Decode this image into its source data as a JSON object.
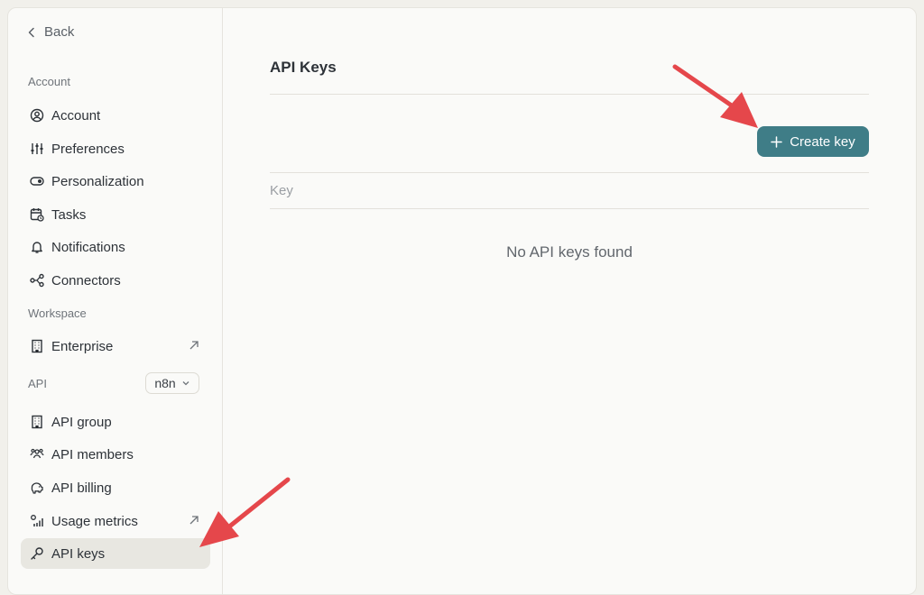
{
  "sidebar": {
    "back_label": "Back",
    "sections": {
      "account": "Account",
      "workspace": "Workspace",
      "api": "API"
    },
    "account_items": [
      {
        "label": "Account",
        "icon": "user-circle-icon"
      },
      {
        "label": "Preferences",
        "icon": "sliders-icon"
      },
      {
        "label": "Personalization",
        "icon": "toggle-icon"
      },
      {
        "label": "Tasks",
        "icon": "calendar-clock-icon"
      },
      {
        "label": "Notifications",
        "icon": "bell-icon"
      },
      {
        "label": "Connectors",
        "icon": "connectors-icon"
      }
    ],
    "workspace_items": [
      {
        "label": "Enterprise",
        "icon": "building-icon",
        "external": true
      }
    ],
    "api_project": "n8n",
    "api_items": [
      {
        "label": "API group",
        "icon": "building-icon"
      },
      {
        "label": "API members",
        "icon": "users-icon"
      },
      {
        "label": "API billing",
        "icon": "piggy-bank-icon"
      },
      {
        "label": "Usage metrics",
        "icon": "chart-icon",
        "external": true
      },
      {
        "label": "API keys",
        "icon": "key-icon",
        "active": true
      }
    ]
  },
  "main": {
    "title": "API Keys",
    "create_button_label": "Create key",
    "table_header": "Key",
    "empty_message": "No API keys found"
  },
  "colors": {
    "accent": "#3f7d87",
    "annotation_arrow": "#e5474b",
    "active_item_bg": "#e8e7e1"
  }
}
